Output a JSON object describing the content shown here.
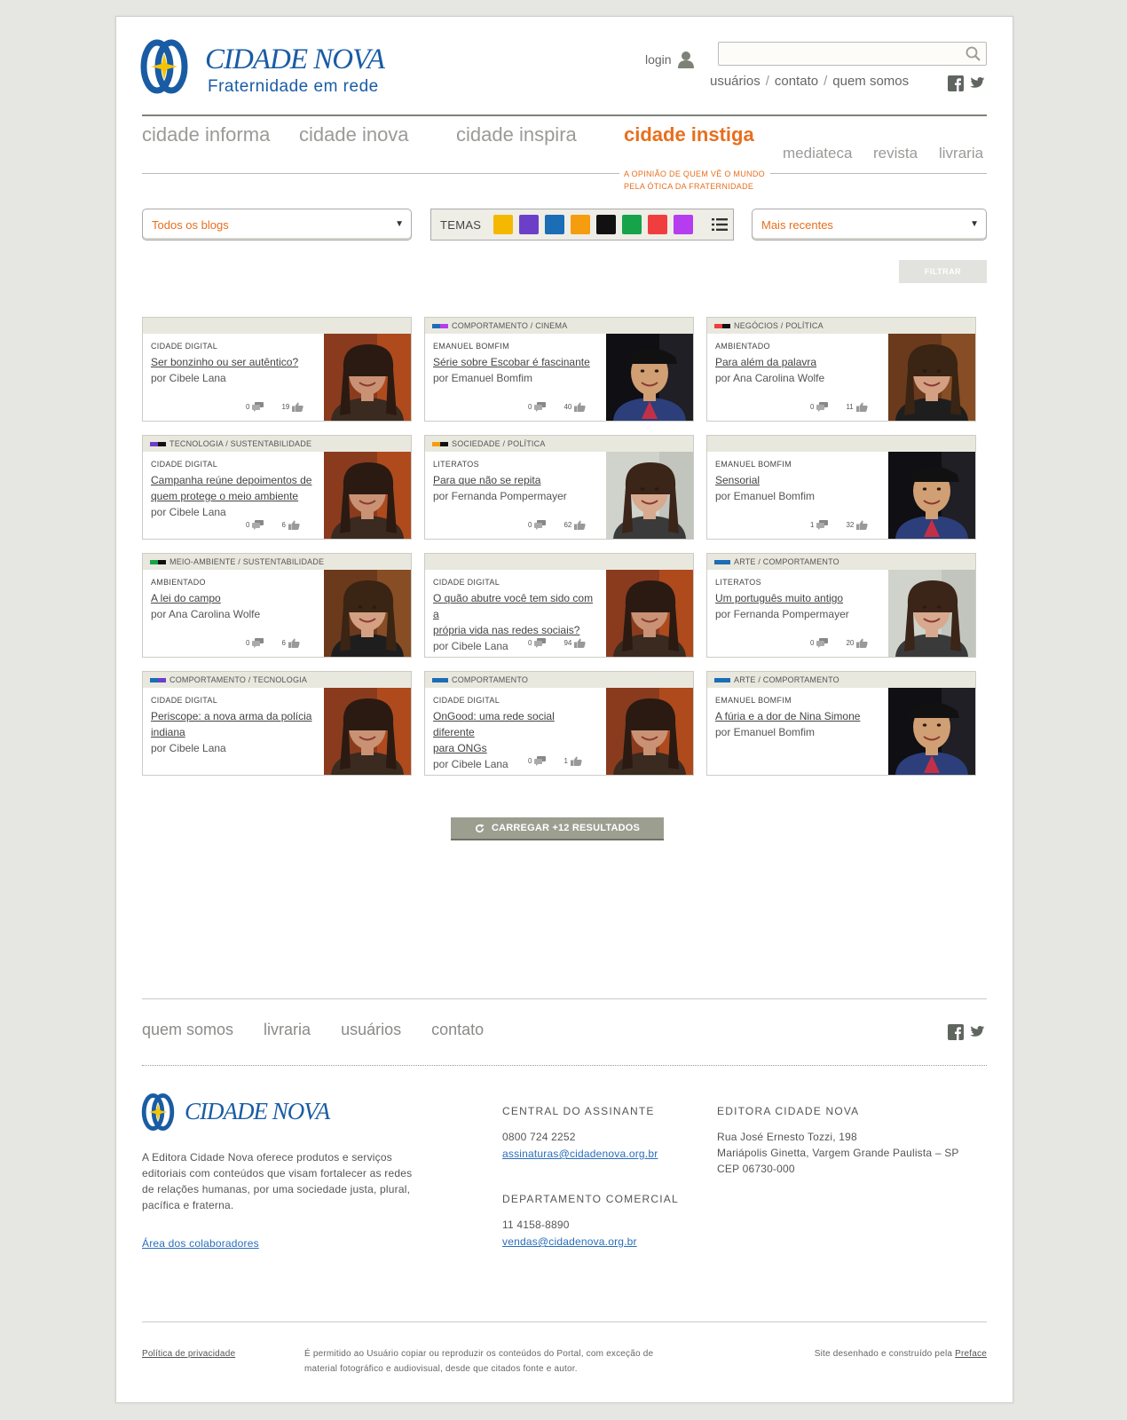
{
  "header": {
    "logo_name": "CIDADE NOVA",
    "logo_tagline": "Fraternidade em rede",
    "login_label": "login",
    "search_placeholder": "",
    "top_links": [
      "usuários",
      "contato",
      "quem somos"
    ],
    "top_sep": "/"
  },
  "nav": {
    "items": [
      "cidade informa",
      "cidade inova",
      "cidade inspira",
      "cidade instiga",
      "mediateca",
      "revista",
      "livraria"
    ],
    "active_index": 3,
    "active_subtitle_1": "A OPINIÃO DE QUEM VÊ O MUNDO",
    "active_subtitle_2": "PELA ÓTICA DA FRATERNIDADE"
  },
  "filters": {
    "blogs_select": "Todos os blogs",
    "order_select": "Mais recentes",
    "temas_label": "TEMAS",
    "temas_colors": [
      "#f5b800",
      "#6c3fc9",
      "#1b6db5",
      "#f59d0e",
      "#111111",
      "#16a34a",
      "#f03e3e",
      "#b63cf0"
    ],
    "filter_button": "FILTRAR"
  },
  "colors": {
    "accent": "#e76f1e",
    "brand_blue": "#1a5ca4"
  },
  "cards": [
    {
      "category": "",
      "bar": [],
      "blog": "CIDADE DIGITAL",
      "title": [
        "Ser bonzinho ou ser autêntico?"
      ],
      "author": "por Cibele Lana",
      "comments": "0",
      "likes": "19",
      "avatar": "woman1"
    },
    {
      "category": "COMPORTAMENTO / CINEMA",
      "bar": [
        "#1b6db5",
        "#b63cf0"
      ],
      "blog": "EMANUEL BOMFIM",
      "title": [
        "Série sobre Escobar é fascinante"
      ],
      "author": "por Emanuel Bomfim",
      "comments": "0",
      "likes": "40",
      "avatar": "man1"
    },
    {
      "category": "NEGÓCIOS / POLÍTICA",
      "bar": [
        "#f03e3e",
        "#111111"
      ],
      "blog": "AMBIENTADO",
      "title": [
        "Para além da palavra"
      ],
      "author": "por Ana Carolina Wolfe",
      "comments": "0",
      "likes": "11",
      "avatar": "woman2"
    },
    {
      "category": "TECNOLOGIA / SUSTENTABILIDADE",
      "bar": [
        "#6c3fc9",
        "#111111"
      ],
      "blog": "CIDADE DIGITAL",
      "title": [
        "Campanha reúne depoimentos de",
        "quem protege o meio ambiente"
      ],
      "author": "por Cibele Lana",
      "comments": "0",
      "likes": "6",
      "avatar": "woman1"
    },
    {
      "category": "SOCIEDADE / POLÍTICA",
      "bar": [
        "#f59d0e",
        "#111111"
      ],
      "blog": "LITERATOS",
      "title": [
        "Para que não se repita"
      ],
      "author": "por Fernanda Pompermayer",
      "comments": "0",
      "likes": "62",
      "avatar": "woman3"
    },
    {
      "category": "",
      "bar": [],
      "blog": "EMANUEL BOMFIM",
      "title": [
        "Sensorial"
      ],
      "author": "por Emanuel Bomfim",
      "comments": "1",
      "likes": "32",
      "avatar": "man1"
    },
    {
      "category": "MEIO-AMBIENTE / SUSTENTABILIDADE",
      "bar": [
        "#16a34a",
        "#111111"
      ],
      "blog": "AMBIENTADO",
      "title": [
        "A lei do campo"
      ],
      "author": "por Ana Carolina Wolfe",
      "comments": "0",
      "likes": "6",
      "avatar": "woman2"
    },
    {
      "category": "",
      "bar": [],
      "blog": "CIDADE DIGITAL",
      "title": [
        "O quão abutre você tem sido com a",
        "própria vida nas redes sociais?"
      ],
      "author": "por Cibele Lana",
      "comments": "0",
      "likes": "94",
      "avatar": "woman1"
    },
    {
      "category": "ARTE / COMPORTAMENTO",
      "bar": [
        "#1b6db5"
      ],
      "blog": "LITERATOS",
      "title": [
        "Um português muito antigo"
      ],
      "author": "por Fernanda Pompermayer",
      "comments": "0",
      "likes": "20",
      "avatar": "woman3"
    },
    {
      "category": "COMPORTAMENTO / TECNOLOGIA",
      "bar": [
        "#1b6db5",
        "#6c3fc9"
      ],
      "blog": "CIDADE DIGITAL",
      "title": [
        "Periscope: a nova arma da polícia",
        "indiana"
      ],
      "author": "por Cibele Lana",
      "comments": "",
      "likes": "",
      "avatar": "woman1"
    },
    {
      "category": "COMPORTAMENTO",
      "bar": [
        "#1b6db5"
      ],
      "blog": "CIDADE DIGITAL",
      "title": [
        "OnGood: uma rede social diferente",
        "para ONGs"
      ],
      "author": "por Cibele Lana",
      "comments": "0",
      "likes": "1",
      "avatar": "woman1"
    },
    {
      "category": "ARTE / COMPORTAMENTO",
      "bar": [
        "#1b6db5"
      ],
      "blog": "EMANUEL BOMFIM",
      "title": [
        "A fúria e a dor de Nina Simone"
      ],
      "author": "por Emanuel Bomfim",
      "comments": "",
      "likes": "",
      "avatar": "man1"
    }
  ],
  "load_more": "CARREGAR +12 RESULTADOS",
  "footer": {
    "nav": [
      "quem somos",
      "livraria",
      "usuários",
      "contato"
    ],
    "logo_name": "CIDADE NOVA",
    "description": "A Editora Cidade Nova oferece produtos e serviços editoriais com conteúdos que visam fortalecer as redes de relações humanas, por uma sociedade justa, plural, pacífica e fraterna.",
    "collaborators_link": "Área dos colaboradores",
    "central_title": "CENTRAL DO ASSINANTE",
    "central_phone": "0800 724 2252",
    "central_email": "assinaturas@cidadenova.org.br",
    "comercial_title": "DEPARTAMENTO COMERCIAL",
    "comercial_phone": "11 4158-8890",
    "comercial_email": "vendas@cidadenova.org.br",
    "editora_title": "EDITORA CIDADE NOVA",
    "editora_address_1": "Rua José Ernesto Tozzi, 198",
    "editora_address_2": "Mariápolis Ginetta, Vargem Grande Paulista – SP",
    "editora_address_3": "CEP 06730-000",
    "privacy": "Política de privacidade",
    "legal_1": "É permitido ao Usuário copiar ou reproduzir os conteúdos do Portal, com exceção de",
    "legal_2": "material fotográfico e audiovisual, desde que citados fonte e autor.",
    "credit_prefix": "Site desenhado e construído pela",
    "credit_link": "Preface"
  }
}
